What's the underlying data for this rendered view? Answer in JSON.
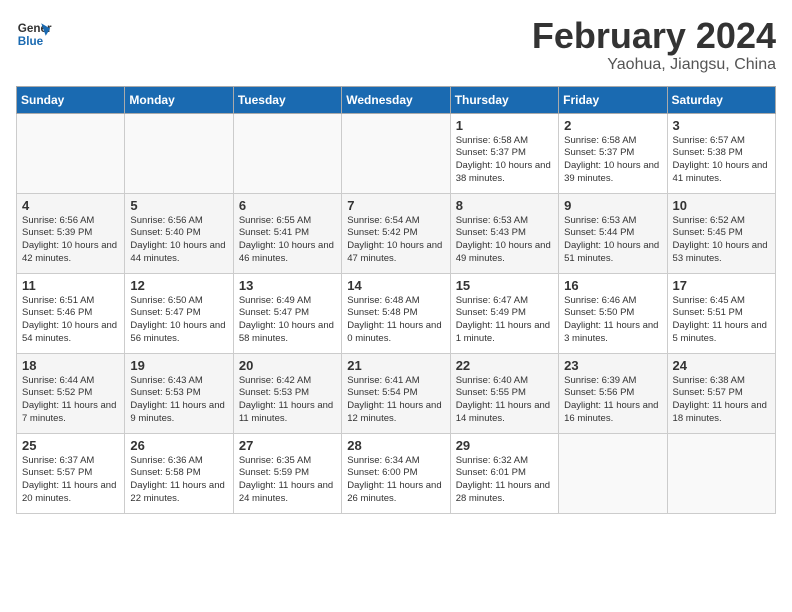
{
  "header": {
    "logo_line1": "General",
    "logo_line2": "Blue",
    "title": "February 2024",
    "location": "Yaohua, Jiangsu, China"
  },
  "weekdays": [
    "Sunday",
    "Monday",
    "Tuesday",
    "Wednesday",
    "Thursday",
    "Friday",
    "Saturday"
  ],
  "weeks": [
    [
      {
        "day": "",
        "info": ""
      },
      {
        "day": "",
        "info": ""
      },
      {
        "day": "",
        "info": ""
      },
      {
        "day": "",
        "info": ""
      },
      {
        "day": "1",
        "info": "Sunrise: 6:58 AM\nSunset: 5:37 PM\nDaylight: 10 hours\nand 38 minutes."
      },
      {
        "day": "2",
        "info": "Sunrise: 6:58 AM\nSunset: 5:37 PM\nDaylight: 10 hours\nand 39 minutes."
      },
      {
        "day": "3",
        "info": "Sunrise: 6:57 AM\nSunset: 5:38 PM\nDaylight: 10 hours\nand 41 minutes."
      }
    ],
    [
      {
        "day": "4",
        "info": "Sunrise: 6:56 AM\nSunset: 5:39 PM\nDaylight: 10 hours\nand 42 minutes."
      },
      {
        "day": "5",
        "info": "Sunrise: 6:56 AM\nSunset: 5:40 PM\nDaylight: 10 hours\nand 44 minutes."
      },
      {
        "day": "6",
        "info": "Sunrise: 6:55 AM\nSunset: 5:41 PM\nDaylight: 10 hours\nand 46 minutes."
      },
      {
        "day": "7",
        "info": "Sunrise: 6:54 AM\nSunset: 5:42 PM\nDaylight: 10 hours\nand 47 minutes."
      },
      {
        "day": "8",
        "info": "Sunrise: 6:53 AM\nSunset: 5:43 PM\nDaylight: 10 hours\nand 49 minutes."
      },
      {
        "day": "9",
        "info": "Sunrise: 6:53 AM\nSunset: 5:44 PM\nDaylight: 10 hours\nand 51 minutes."
      },
      {
        "day": "10",
        "info": "Sunrise: 6:52 AM\nSunset: 5:45 PM\nDaylight: 10 hours\nand 53 minutes."
      }
    ],
    [
      {
        "day": "11",
        "info": "Sunrise: 6:51 AM\nSunset: 5:46 PM\nDaylight: 10 hours\nand 54 minutes."
      },
      {
        "day": "12",
        "info": "Sunrise: 6:50 AM\nSunset: 5:47 PM\nDaylight: 10 hours\nand 56 minutes."
      },
      {
        "day": "13",
        "info": "Sunrise: 6:49 AM\nSunset: 5:47 PM\nDaylight: 10 hours\nand 58 minutes."
      },
      {
        "day": "14",
        "info": "Sunrise: 6:48 AM\nSunset: 5:48 PM\nDaylight: 11 hours\nand 0 minutes."
      },
      {
        "day": "15",
        "info": "Sunrise: 6:47 AM\nSunset: 5:49 PM\nDaylight: 11 hours\nand 1 minute."
      },
      {
        "day": "16",
        "info": "Sunrise: 6:46 AM\nSunset: 5:50 PM\nDaylight: 11 hours\nand 3 minutes."
      },
      {
        "day": "17",
        "info": "Sunrise: 6:45 AM\nSunset: 5:51 PM\nDaylight: 11 hours\nand 5 minutes."
      }
    ],
    [
      {
        "day": "18",
        "info": "Sunrise: 6:44 AM\nSunset: 5:52 PM\nDaylight: 11 hours\nand 7 minutes."
      },
      {
        "day": "19",
        "info": "Sunrise: 6:43 AM\nSunset: 5:53 PM\nDaylight: 11 hours\nand 9 minutes."
      },
      {
        "day": "20",
        "info": "Sunrise: 6:42 AM\nSunset: 5:53 PM\nDaylight: 11 hours\nand 11 minutes."
      },
      {
        "day": "21",
        "info": "Sunrise: 6:41 AM\nSunset: 5:54 PM\nDaylight: 11 hours\nand 12 minutes."
      },
      {
        "day": "22",
        "info": "Sunrise: 6:40 AM\nSunset: 5:55 PM\nDaylight: 11 hours\nand 14 minutes."
      },
      {
        "day": "23",
        "info": "Sunrise: 6:39 AM\nSunset: 5:56 PM\nDaylight: 11 hours\nand 16 minutes."
      },
      {
        "day": "24",
        "info": "Sunrise: 6:38 AM\nSunset: 5:57 PM\nDaylight: 11 hours\nand 18 minutes."
      }
    ],
    [
      {
        "day": "25",
        "info": "Sunrise: 6:37 AM\nSunset: 5:57 PM\nDaylight: 11 hours\nand 20 minutes."
      },
      {
        "day": "26",
        "info": "Sunrise: 6:36 AM\nSunset: 5:58 PM\nDaylight: 11 hours\nand 22 minutes."
      },
      {
        "day": "27",
        "info": "Sunrise: 6:35 AM\nSunset: 5:59 PM\nDaylight: 11 hours\nand 24 minutes."
      },
      {
        "day": "28",
        "info": "Sunrise: 6:34 AM\nSunset: 6:00 PM\nDaylight: 11 hours\nand 26 minutes."
      },
      {
        "day": "29",
        "info": "Sunrise: 6:32 AM\nSunset: 6:01 PM\nDaylight: 11 hours\nand 28 minutes."
      },
      {
        "day": "",
        "info": ""
      },
      {
        "day": "",
        "info": ""
      }
    ]
  ]
}
